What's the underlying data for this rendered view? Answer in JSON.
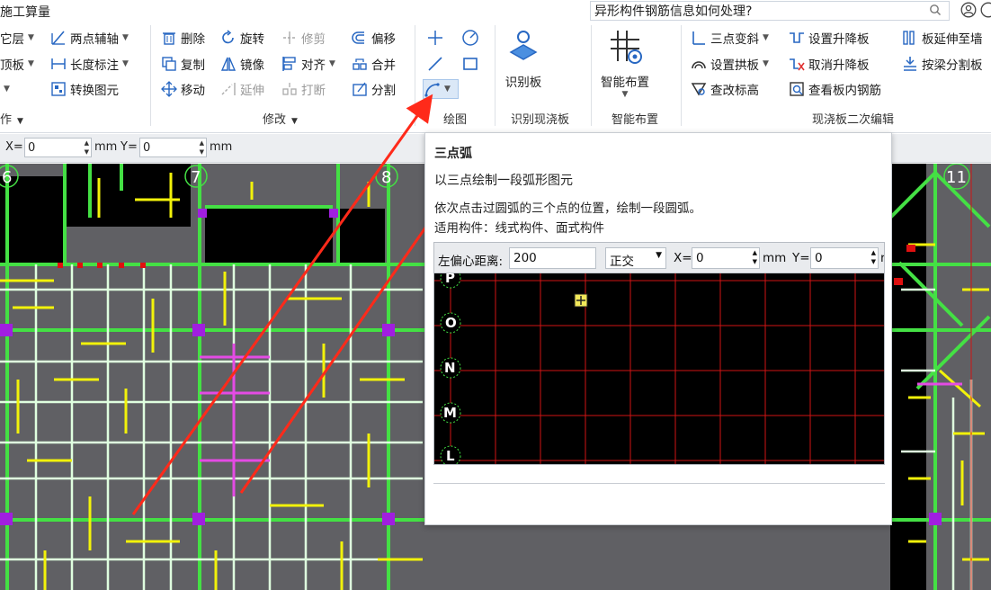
{
  "app": {
    "title": "施工算量",
    "help_search_value": "异形构件钢筋信息如何处理?"
  },
  "ribbon": {
    "col1": [
      "它层",
      "顶板",
      "作"
    ],
    "col2": [
      "两点辅轴",
      "长度标注",
      "转换图元"
    ],
    "modify": {
      "delete": "删除",
      "rotate": "旋转",
      "trim": "修剪",
      "offset": "偏移",
      "copy": "复制",
      "mirror": "镜像",
      "align": "对齐",
      "merge": "合并",
      "move": "移动",
      "extend": "延伸",
      "break": "打断",
      "split": "分割"
    },
    "recognize_slab": "识别板",
    "smart_layout": "智能布置",
    "edit": {
      "three_point_slope": "三点变斜",
      "set_lift": "设置升降板",
      "extend_to_wall": "板延伸至墙",
      "set_arch": "设置拱板",
      "cancel_lift": "取消升降板",
      "split_by_beam": "按梁分割板",
      "check_elev": "查改标高",
      "view_rebar": "查看板内钢筋"
    },
    "groups": {
      "modify": "修改",
      "draw": "绘图",
      "recognize": "识别现浇板",
      "smart": "智能布置",
      "edit": "现浇板二次编辑"
    }
  },
  "coordbar": {
    "x_label": "X=",
    "x_value": "0",
    "unit1": "mm",
    "y_label": "Y=",
    "y_value": "0",
    "unit2": "mm"
  },
  "cad": {
    "axis_labels": [
      "6",
      "7",
      "8",
      "11"
    ]
  },
  "tooltip": {
    "title": "三点弧",
    "desc": "以三点绘制一段弧形图元",
    "detail": "依次点击过圆弧的三个点的位置，绘制一段圆弧。",
    "apply": "适用构件：线式构件、面式构件",
    "preview": {
      "offset_label": "左偏心距离:",
      "offset_value": "200",
      "mode": "正交",
      "x_label": "X=",
      "x_value": "0",
      "unit": "mm",
      "y_label": "Y=",
      "y_value": "0",
      "unit_cut": "r",
      "axis_labels": [
        "P",
        "O",
        "N",
        "M",
        "L"
      ]
    }
  },
  "colors": {
    "cad_bg": "#606064",
    "beam_green": "#44e044",
    "rebar_yellow": "#f2f20a",
    "rebar_white": "#e8ffe8",
    "magenta": "#e44be4",
    "red_arrow": "#ff2a1a",
    "grid_red": "#d01414"
  }
}
